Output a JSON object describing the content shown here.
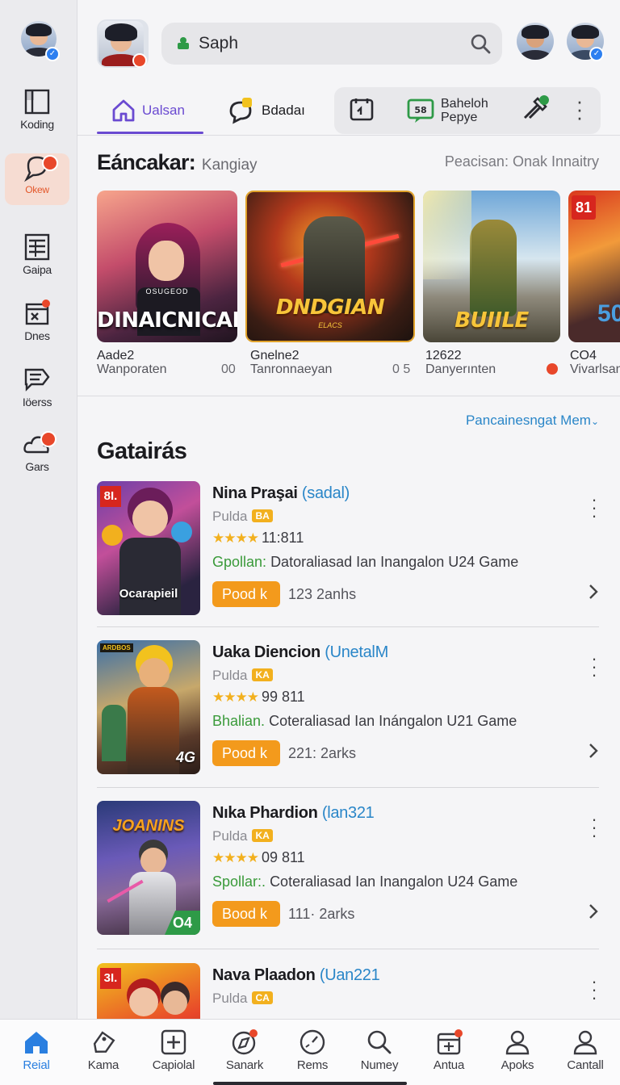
{
  "rail": {
    "items": [
      {
        "label": "Koding",
        "icon": "book-icon"
      },
      {
        "label": "Okew",
        "icon": "chat-bubble-icon"
      },
      {
        "label": "Gaipa",
        "icon": "grid-list-icon"
      },
      {
        "label": "Dnes",
        "icon": "calendar-icon"
      },
      {
        "label": "Iöerss",
        "icon": "message-icon"
      },
      {
        "label": "Gars",
        "icon": "cloud-icon"
      }
    ]
  },
  "search": {
    "value": "Saph"
  },
  "tabs": [
    {
      "label": "Ualsan",
      "icon": "home-icon"
    },
    {
      "label": "Bdadaı",
      "icon": "chat-icon"
    }
  ],
  "tab_group": {
    "label_line1": "Baheloh",
    "label_line2": "Pepye",
    "icon_b": "58"
  },
  "featured": {
    "title": "Eáncakar:",
    "subtitle": "Kangiay",
    "right_text": "Peacisan: Onak Innaitry",
    "cards": [
      {
        "caption": "DINAICNICAN",
        "small": "OSUGEOD",
        "line1": "Aade2",
        "line2": "Wanporaten",
        "num": "00"
      },
      {
        "caption": "DNDGIAN",
        "small": "ELACS",
        "line1": "Gnelne2",
        "line2": "Tanronnaeyan",
        "num": "0 5"
      },
      {
        "caption": "BUIILE",
        "small": "",
        "line1": "12622",
        "line2": "Danyerınten",
        "num": ""
      },
      {
        "caption": "50",
        "small": "81",
        "line1": "CO4",
        "line2": "Vivarlsan",
        "num": ""
      }
    ]
  },
  "list": {
    "see_more": "Pancainesngat Mem",
    "title": "Gatairás",
    "rows": [
      {
        "name": "Nina Praşai",
        "tagline": "(sadal)",
        "publisher": "Pulda",
        "chip": "BA",
        "rating": "11:811",
        "genre": "Gpollan:",
        "desc": "Datoraliasad Ian Inangalon U24 Game",
        "button": "Pood k",
        "count": "123 2anhs",
        "thumb_caption": "Ocarapieil",
        "thumb_badge": "8I."
      },
      {
        "name": "Uaka Diencion",
        "tagline": "(UnetalM",
        "publisher": "Pulda",
        "chip": "KA",
        "rating": "99 811",
        "genre": "Bhalian.",
        "desc": "Coteraliasad Ian Inángalon U21 Game",
        "button": "Pood k",
        "count": "221: 2arks",
        "thumb_caption": "4G",
        "thumb_badge": "ARDBOS"
      },
      {
        "name": "Nıka Phardion",
        "tagline": "(lan321",
        "publisher": "Pulda",
        "chip": "KA",
        "rating": "09 811",
        "genre": "Spollar:.",
        "desc": "Coteraliasad Ian Inangalon U24 Game",
        "button": "Bood k",
        "count": "111· 2arks",
        "thumb_caption": "JOANINS",
        "thumb_badge": "O4"
      },
      {
        "name": "Nava Plaadon",
        "tagline": "(Uan221",
        "publisher": "Pulda",
        "chip": "CA",
        "rating": "",
        "genre": "",
        "desc": "",
        "button": "",
        "count": "",
        "thumb_caption": "",
        "thumb_badge": "3I."
      }
    ]
  },
  "bottom_nav": [
    {
      "label": "Reial",
      "icon": "home-icon"
    },
    {
      "label": "Kama",
      "icon": "tag-icon"
    },
    {
      "label": "Capiolal",
      "icon": "plus-square-icon"
    },
    {
      "label": "Sanark",
      "icon": "compass-icon"
    },
    {
      "label": "Rems",
      "icon": "gauge-icon"
    },
    {
      "label": "Numey",
      "icon": "search-icon"
    },
    {
      "label": "Antua",
      "icon": "calendar-badge-icon"
    },
    {
      "label": "Apoks",
      "icon": "person-icon"
    },
    {
      "label": "Cantall",
      "icon": "profile-icon"
    }
  ],
  "colors": {
    "accent": "#6a4ad1",
    "button": "#f39a1c",
    "link": "#2a86c8",
    "badge": "#e8472a",
    "star": "#f2b01e"
  }
}
